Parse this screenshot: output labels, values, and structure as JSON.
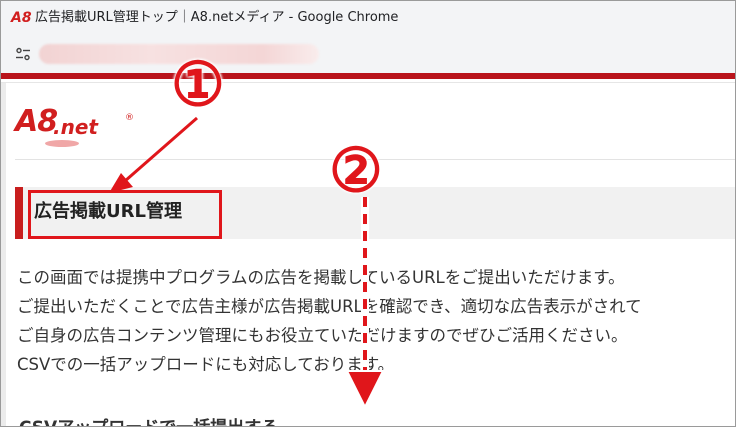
{
  "window": {
    "app_icon_text": "A8",
    "title": "広告掲載URL管理トップ｜A8.netメディア - Google Chrome"
  },
  "address_bar": {
    "site_info_icon": "tune-icon"
  },
  "page": {
    "logo": {
      "main": "A8",
      "suffix": ".net",
      "registered": "®"
    },
    "heading": "広告掲載URL管理",
    "description_lines": [
      "この画面では提携中プログラムの広告を掲載しているURLをご提出いただけます。",
      "ご提出いただくことで広告主様が広告掲載URLを確認でき、適切な広告表示がされて",
      "ご自身の広告コンテンツ管理にもお役立ていただけますのでぜひご活用ください。",
      "CSVでの一括アップロードにも対応しております。"
    ],
    "next_section_heading": "CSVアップロードで一括提出する"
  },
  "annotations": {
    "marker_1": "①",
    "marker_2": "②"
  },
  "colors": {
    "brand_red": "#d11f1f",
    "annotation_red": "#e0161b",
    "chrome_accent": "#b9141b"
  }
}
